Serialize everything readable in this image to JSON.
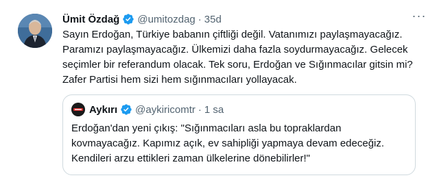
{
  "tweet": {
    "author_name": "Ümit Özdağ",
    "handle": "@umitozdag",
    "separator": "·",
    "time": "35d",
    "more_label": "···",
    "body_lines": [
      "Sayın Erdoğan, Türkiye babanın çiftliği değil. Vatanımızı paylaşmayacağız.",
      "Paramızı paylaşmayacağız. Ülkemizi daha fazla soydurmayacağız. Gelecek",
      "seçimler bir referandum olacak. Tek soru, Erdoğan ve Sığınmacılar gitsin mi?",
      "Zafer Partisi hem sizi hem sığınmacıları yollayacak."
    ]
  },
  "quote": {
    "author_name": "Aykırı",
    "handle": "@aykiricomtr",
    "separator": "·",
    "time": "1 sa",
    "body_lines": [
      "Erdoğan'dan yeni çıkış: \"Sığınmacıları asla bu topraklardan",
      "kovmayacağız. Kapımız açık, ev sahipliği yapmaya devam edeceğiz.",
      "Kendileri arzu ettikleri zaman ülkelerine dönebilirler!\""
    ]
  },
  "colors": {
    "verified": "#1d9bf0",
    "text_primary": "#0f1419",
    "text_secondary": "#536471",
    "border": "#cfd9de"
  },
  "icons": {
    "verified": "verified-badge-icon",
    "more": "more-icon"
  }
}
